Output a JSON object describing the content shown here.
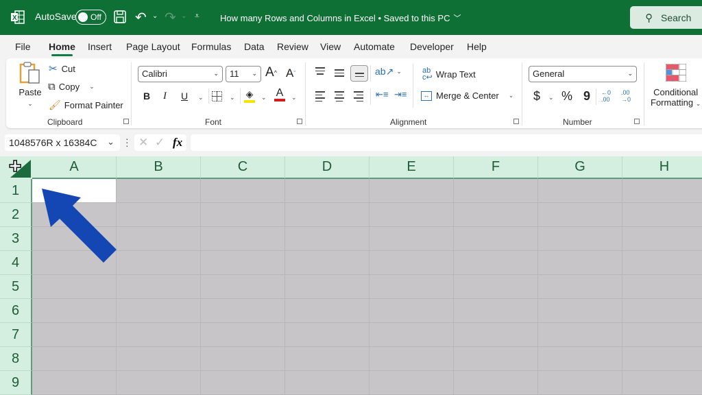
{
  "titlebar": {
    "app_icon": "excel-icon",
    "autosave_label": "AutoSave",
    "autosave_state": "Off",
    "document_title": "How many Rows and Columns in Excel • Saved to this PC",
    "search_label": "Search",
    "colors": {
      "background": "#0f7036",
      "search_bg": "#dcebe1"
    }
  },
  "menu": {
    "tabs": [
      "File",
      "Home",
      "Insert",
      "Page Layout",
      "Formulas",
      "Data",
      "Review",
      "View",
      "Automate",
      "Developer",
      "Help"
    ],
    "active_tab": "Home"
  },
  "ribbon": {
    "clipboard": {
      "label": "Clipboard",
      "paste": "Paste",
      "cut": "Cut",
      "copy": "Copy",
      "format_painter": "Format Painter"
    },
    "font": {
      "label": "Font",
      "font_name": "Calibri",
      "font_size": "11",
      "bold": "B",
      "italic": "I",
      "underline": "U",
      "grow": "A",
      "shrink": "A",
      "font_color": "A",
      "highlight_color": "#f5e400",
      "text_color": "#d11d1d"
    },
    "alignment": {
      "label": "Alignment",
      "wrap_text": "Wrap Text",
      "merge_center": "Merge & Center"
    },
    "number": {
      "label": "Number",
      "format": "General",
      "currency": "$",
      "percent": "%",
      "comma": "9",
      "inc_decimal": "←0 .00",
      "dec_decimal": ".00 →0"
    },
    "styles": {
      "conditional_formatting_line1": "Conditional",
      "conditional_formatting_line2": "Formatting"
    }
  },
  "formula_bar": {
    "name_box": "1048576R x 16384C",
    "cancel": "✕",
    "enter": "✓",
    "fx": "fx",
    "formula": ""
  },
  "sheet": {
    "columns": [
      "A",
      "B",
      "C",
      "D",
      "E",
      "F",
      "G",
      "H"
    ],
    "rows": [
      "1",
      "2",
      "3",
      "4",
      "5",
      "6",
      "7",
      "8",
      "9"
    ],
    "active_cell": "A1",
    "selection": "all",
    "colors": {
      "header_bg": "#d4efe0",
      "header_text": "#1e5c38",
      "selected_fill": "#c8c5c8",
      "arrow": "#1446b4"
    }
  },
  "annotation": {
    "type": "arrow",
    "points_to": "select-all-corner",
    "color": "#1446b4"
  }
}
